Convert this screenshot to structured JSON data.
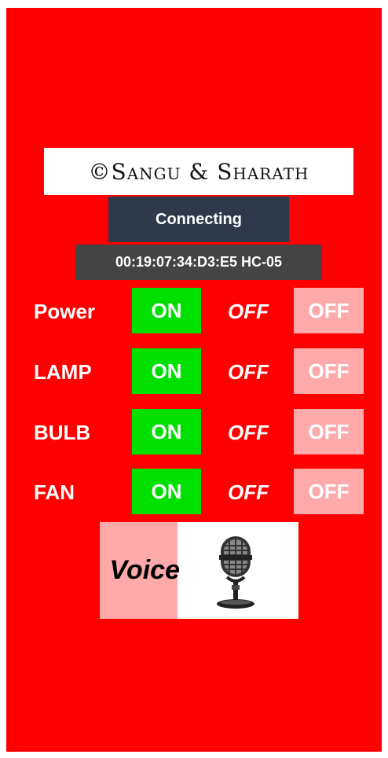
{
  "banner": {
    "text": "©Sangu & Sharath"
  },
  "status": {
    "text": "Connecting"
  },
  "device": {
    "text": "00:19:07:34:D3:E5 HC-05"
  },
  "rows": [
    {
      "label": "Power",
      "on": "ON",
      "state": "OFF",
      "off": "OFF"
    },
    {
      "label": "LAMP",
      "on": "ON",
      "state": "OFF",
      "off": "OFF"
    },
    {
      "label": "BULB",
      "on": "ON",
      "state": "OFF",
      "off": "OFF"
    },
    {
      "label": "FAN",
      "on": "ON",
      "state": "OFF",
      "off": "OFF"
    }
  ],
  "voice": {
    "label": "Voice",
    "icon": "microphone-icon"
  },
  "colors": {
    "background": "#ff0000",
    "on": "#00e000",
    "off": "#ffaaaa",
    "status": "#2e3a4a",
    "address": "#444444"
  }
}
